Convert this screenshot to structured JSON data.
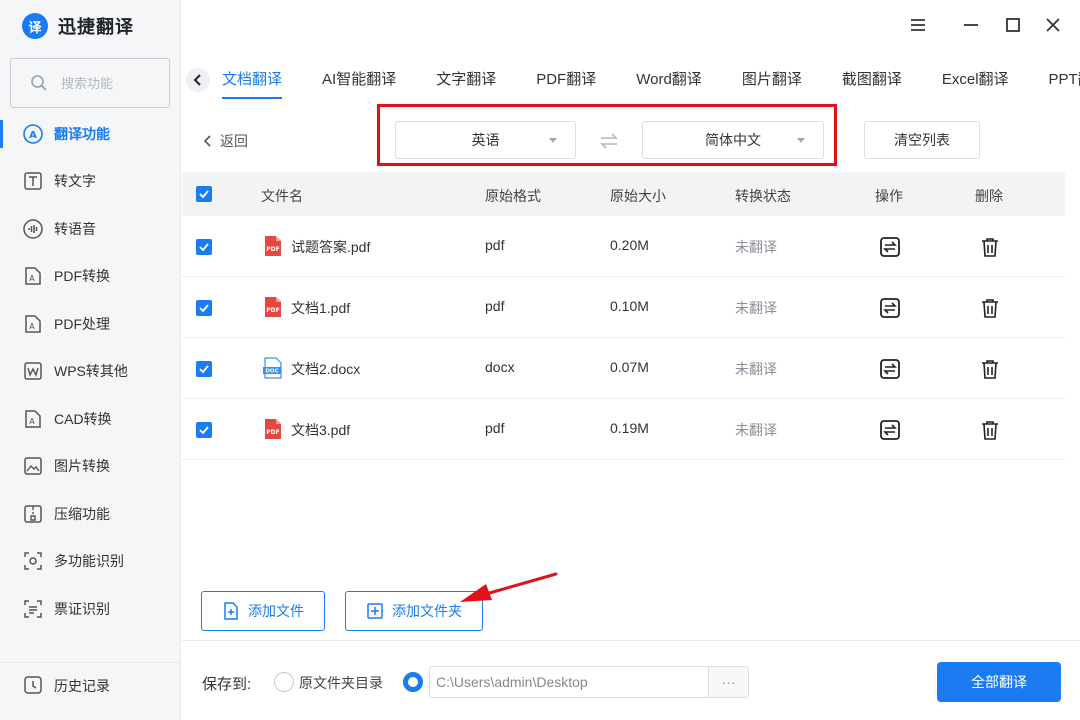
{
  "app": {
    "title": "迅捷翻译",
    "logo_char": "译"
  },
  "search": {
    "placeholder": "搜索功能"
  },
  "sidebar": {
    "items": [
      {
        "label": "翻译功能",
        "icon": "translate-icon",
        "active": true
      },
      {
        "label": "转文字",
        "icon": "text-convert-icon"
      },
      {
        "label": "转语音",
        "icon": "voice-icon"
      },
      {
        "label": "PDF转换",
        "icon": "pdf-convert-icon"
      },
      {
        "label": "PDF处理",
        "icon": "pdf-process-icon"
      },
      {
        "label": "WPS转其他",
        "icon": "wps-icon"
      },
      {
        "label": "CAD转换",
        "icon": "cad-icon"
      },
      {
        "label": "图片转换",
        "icon": "image-convert-icon"
      },
      {
        "label": "压缩功能",
        "icon": "compress-icon"
      },
      {
        "label": "多功能识别",
        "icon": "recognize-icon"
      },
      {
        "label": "票证识别",
        "icon": "ticket-icon"
      }
    ],
    "history": "历史记录"
  },
  "tabs": [
    "文档翻译",
    "AI智能翻译",
    "文字翻译",
    "PDF翻译",
    "Word翻译",
    "图片翻译",
    "截图翻译",
    "Excel翻译",
    "PPT翻译"
  ],
  "back_label": "返回",
  "source_lang": "英语",
  "target_lang": "简体中文",
  "clear_label": "清空列表",
  "table": {
    "headers": [
      "文件名",
      "原始格式",
      "原始大小",
      "转换状态",
      "操作",
      "删除"
    ],
    "rows": [
      {
        "name": "试题答案.pdf",
        "format": "pdf",
        "size": "0.20M",
        "status": "未翻译",
        "type": "PDF"
      },
      {
        "name": "文档1.pdf",
        "format": "pdf",
        "size": "0.10M",
        "status": "未翻译",
        "type": "PDF"
      },
      {
        "name": "文档2.docx",
        "format": "docx",
        "size": "0.07M",
        "status": "未翻译",
        "type": "DOC"
      },
      {
        "name": "文档3.pdf",
        "format": "pdf",
        "size": "0.19M",
        "status": "未翻译",
        "type": "PDF"
      }
    ]
  },
  "add_file": "添加文件",
  "add_folder": "添加文件夹",
  "footer": {
    "save_to": "保存到:",
    "option_original": "原文件夹目录",
    "path": "C:\\Users\\admin\\Desktop",
    "browse": "···",
    "translate_all": "全部翻译"
  },
  "colors": {
    "accent": "#1a7cf0",
    "highlight": "#e3101a",
    "pdf": "#e5483f",
    "doc": "#3b8ee8"
  }
}
